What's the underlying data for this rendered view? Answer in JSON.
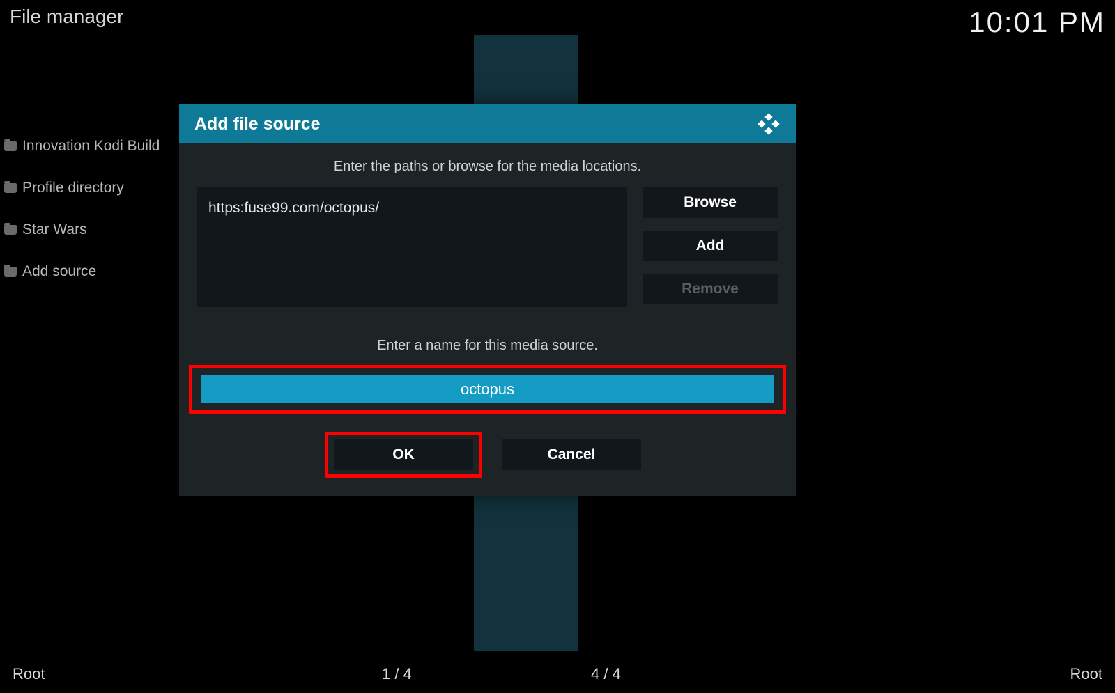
{
  "header": {
    "title": "File manager",
    "clock": "10:01 PM"
  },
  "left_sources": [
    {
      "label": "Innovation Kodi Build"
    },
    {
      "label": "Profile directory"
    },
    {
      "label": "Star Wars"
    },
    {
      "label": "Add source"
    }
  ],
  "status": {
    "left_breadcrumb": "Root",
    "left_count": "1 / 4",
    "right_count": "4 / 4",
    "right_breadcrumb": "Root"
  },
  "dialog": {
    "title": "Add file source",
    "instruction_paths": "Enter the paths or browse for the media locations.",
    "path_value": "https:fuse99.com/octopus/",
    "buttons": {
      "browse": "Browse",
      "add": "Add",
      "remove": "Remove"
    },
    "instruction_name": "Enter a name for this media source.",
    "name_value": "octopus",
    "ok": "OK",
    "cancel": "Cancel"
  },
  "colors": {
    "accent": "#0e7a97",
    "highlight_fill": "#159cc4",
    "annotation": "#ff0000"
  }
}
